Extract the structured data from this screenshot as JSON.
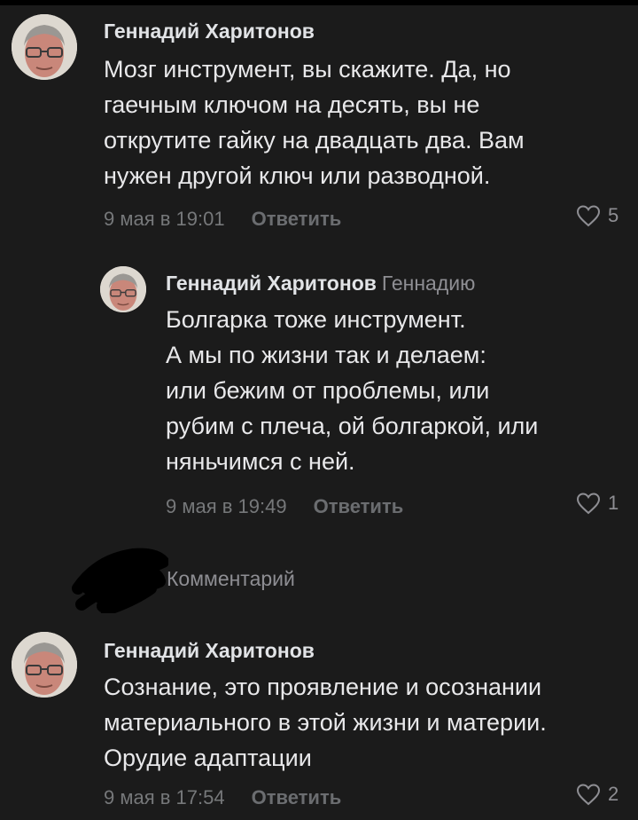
{
  "comments": [
    {
      "author": "Геннадий Харитонов",
      "lines": [
        "Мозг инструмент, вы скажите. Да, но",
        "гаечным ключом на десять, вы не",
        "открутите гайку на двадцать два. Вам",
        "нужен другой ключ или разводной."
      ],
      "date": "9 мая в 19:01",
      "reply_label": "Ответить",
      "likes": "5"
    },
    {
      "author": "Геннадий Харитонов",
      "reply_to": "Геннадию",
      "lines": [
        "Болгарка тоже инструмент.",
        "А мы по жизни так и делаем:",
        "или бежим от проблемы, или",
        "рубим с плеча, ой болгаркой, или",
        "няньчимся с ней."
      ],
      "date": "9 мая в 19:49",
      "reply_label": "Ответить",
      "likes": "1"
    },
    {
      "author": "Геннадий Харитонов",
      "lines": [
        "Сознание, это проявление и осознании",
        "материального в этой жизни и материи.",
        "Орудие адаптации"
      ],
      "date": "9 мая в 17:54",
      "reply_label": "Ответить",
      "likes": "2"
    }
  ],
  "composer": {
    "placeholder": "Комментарий"
  },
  "colors": {
    "background": "#1b1b1b",
    "text": "#e8e8ea",
    "secondary": "#76787a"
  },
  "icons": [
    "avatar",
    "heart-icon"
  ]
}
